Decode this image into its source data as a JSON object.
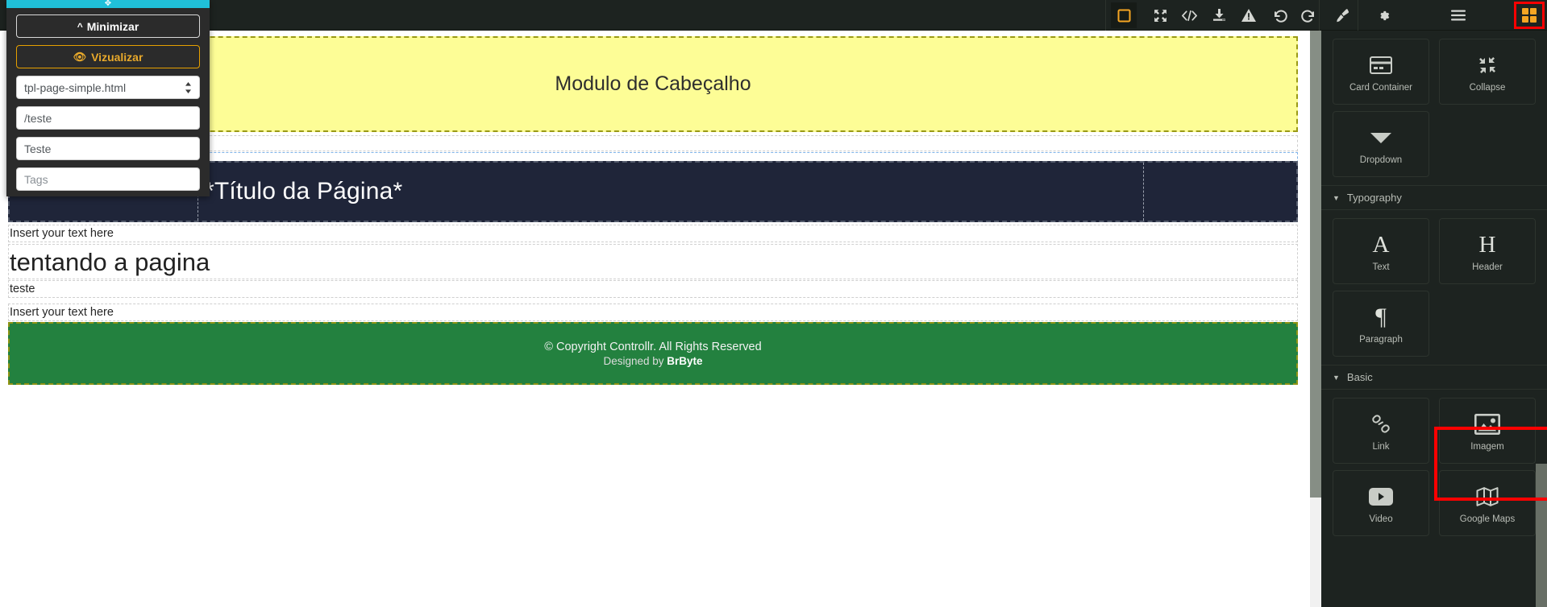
{
  "toolbar": {
    "icons": [
      {
        "name": "select-box-icon",
        "glyph": "box",
        "active": true
      },
      {
        "name": "fullscreen-icon",
        "glyph": "expand",
        "active": false
      },
      {
        "name": "code-view-icon",
        "glyph": "code",
        "active": false
      },
      {
        "name": "download-icon",
        "glyph": "import",
        "active": false
      },
      {
        "name": "warning-icon",
        "glyph": "warning",
        "active": false
      },
      {
        "name": "undo-icon",
        "glyph": "undo",
        "active": false
      },
      {
        "name": "redo-icon",
        "glyph": "redo",
        "active": false
      },
      {
        "name": "paint-brush-icon",
        "glyph": "brush",
        "active": false
      },
      {
        "name": "settings-gear-icon",
        "glyph": "gear",
        "active": false
      },
      {
        "name": "layers-menu-icon",
        "glyph": "hamburger",
        "active": false
      },
      {
        "name": "blocks-grid-icon",
        "glyph": "grid",
        "active": false
      }
    ],
    "accent_color": "#f5a623",
    "highlight_color": "#fb0000",
    "background": "#1d2320"
  },
  "left_panel": {
    "drag_handle_glyph": "✥",
    "drag_handle_color": "#20c0d9",
    "minimize_button": {
      "label": "Minimizar",
      "chevron": "︿"
    },
    "preview_button": {
      "label": "Vizualizar",
      "icon": "eye-icon"
    },
    "template_select": {
      "value": "tpl-page-simple.html"
    },
    "route_field": {
      "value": "/teste"
    },
    "name_field": {
      "value": "Teste"
    },
    "tags_field": {
      "value": "",
      "placeholder": "Tags"
    }
  },
  "canvas": {
    "header_module": {
      "text": "Modulo de Cabeçalho",
      "background": "#fdfd96",
      "border": "#9a9a15"
    },
    "page_title": {
      "text": "*Título da Página*",
      "background": "#1f2539"
    },
    "rows": [
      {
        "name": "text-placeholder-row",
        "text": "Insert your text here",
        "size": "small"
      },
      {
        "name": "heading-row",
        "text": "tentando a pagina",
        "size": "large"
      },
      {
        "name": "text-row",
        "text": "teste",
        "size": "small"
      },
      {
        "name": "text-placeholder-row-2",
        "text": "Insert your text here",
        "size": "small"
      }
    ],
    "footer_module": {
      "line1": "© Copyright Controllr. All Rights Reserved",
      "line2_prefix": "Designed by ",
      "line2_brand": "BrByte",
      "background": "#23813f"
    }
  },
  "right_sidebar": {
    "groups": [
      {
        "section": null,
        "items": [
          {
            "label": "Card Container",
            "icon": "card-container-icon"
          },
          {
            "label": "Collapse",
            "icon": "collapse-icon"
          },
          {
            "label": "Dropdown",
            "icon": "dropdown-icon"
          }
        ]
      },
      {
        "section": "Typography",
        "items": [
          {
            "label": "Text",
            "icon": "text-a-icon"
          },
          {
            "label": "Header",
            "icon": "header-h-icon"
          },
          {
            "label": "Paragraph",
            "icon": "paragraph-pilcrow-icon"
          }
        ]
      },
      {
        "section": "Basic",
        "items": [
          {
            "label": "Link",
            "icon": "link-chain-icon"
          },
          {
            "label": "Imagem",
            "icon": "image-icon",
            "highlighted": true
          },
          {
            "label": "Video",
            "icon": "video-youtube-icon"
          },
          {
            "label": "Google Maps",
            "icon": "map-icon"
          }
        ]
      }
    ]
  }
}
